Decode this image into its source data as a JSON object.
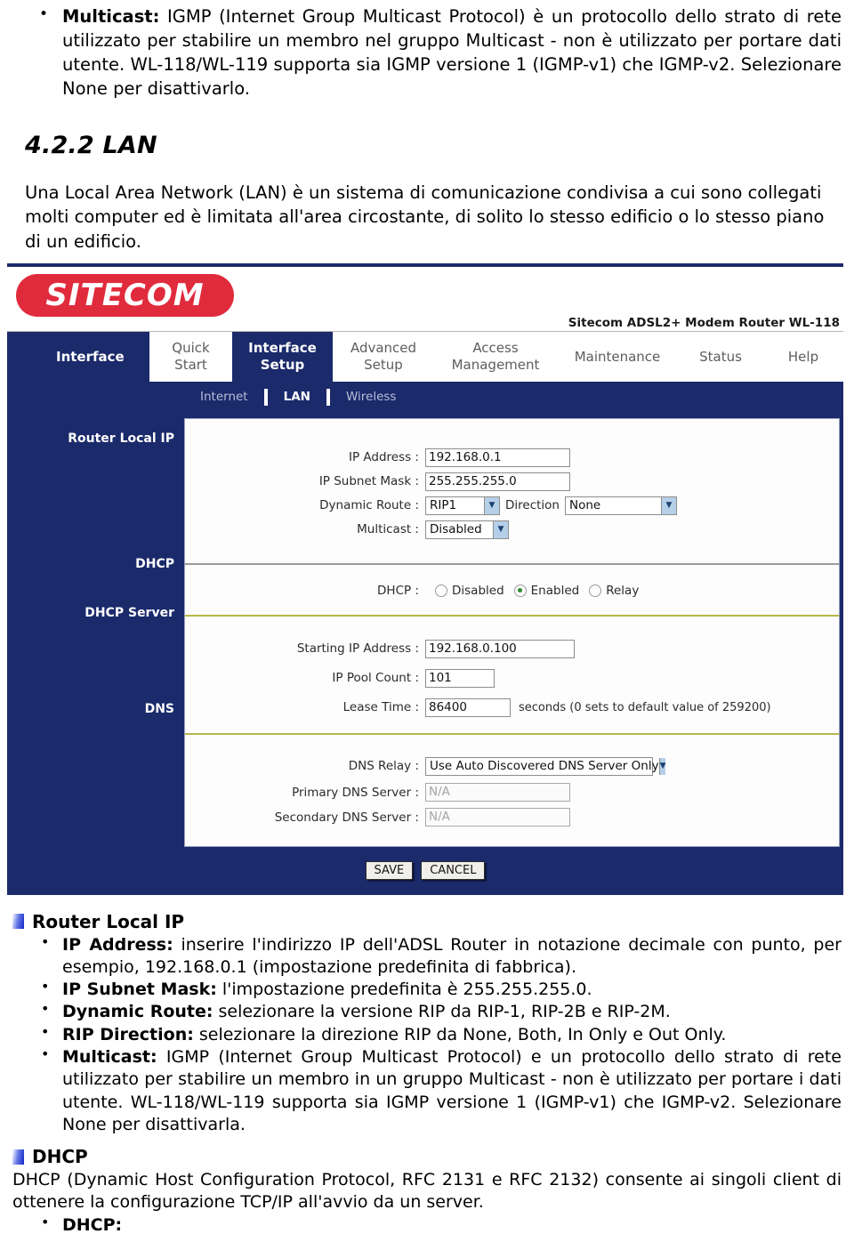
{
  "doc_top": {
    "multicast_bullet": {
      "label": "Multicast:",
      "text": " IGMP (Internet Group Multicast Protocol) è un protocollo dello strato di rete utilizzato per stabilire un membro nel gruppo Multicast - non è utilizzato per portare dati utente. WL-118/WL-119 supporta sia IGMP versione 1 (IGMP-v1) che IGMP-v2. Selezionare None per disattivarlo."
    },
    "section_title": "4.2.2 LAN",
    "intro": "Una Local Area Network (LAN) è un sistema di comunicazione condivisa a cui sono collegati molti computer ed è limitata all'area circostante, di solito lo stesso edificio o lo stesso piano di un edificio."
  },
  "router_ui": {
    "logo_text": "SITECOM",
    "model_name": "Sitecom ADSL2+ Modem Router WL-118",
    "nav_left_label": "Interface",
    "tabs": [
      {
        "line1": "Quick",
        "line2": "Start",
        "active": false
      },
      {
        "line1": "Interface",
        "line2": "Setup",
        "active": true
      },
      {
        "line1": "Advanced",
        "line2": "Setup",
        "active": false
      },
      {
        "line1": "Access",
        "line2": "Management",
        "active": false
      },
      {
        "line1": "Maintenance",
        "line2": "",
        "active": false
      },
      {
        "line1": "Status",
        "line2": "",
        "active": false
      },
      {
        "line1": "Help",
        "line2": "",
        "active": false
      }
    ],
    "subnav": [
      {
        "label": "Internet",
        "active": false
      },
      {
        "label": "LAN",
        "active": true
      },
      {
        "label": "Wireless",
        "active": false
      }
    ],
    "side_labels": {
      "router_local_ip": "Router Local IP",
      "dhcp": "DHCP",
      "dhcp_server": "DHCP Server",
      "dns": "DNS"
    },
    "router_local_ip": {
      "ip_address_label": "IP Address :",
      "ip_address_value": "192.168.0.1",
      "subnet_label": "IP Subnet Mask :",
      "subnet_value": "255.255.255.0",
      "dynamic_route_label": "Dynamic Route :",
      "dynamic_route_value": "RIP1",
      "direction_label": "Direction",
      "direction_value": "None",
      "multicast_label": "Multicast :",
      "multicast_value": "Disabled"
    },
    "dhcp": {
      "label": "DHCP :",
      "options": [
        {
          "label": "Disabled",
          "selected": false
        },
        {
          "label": "Enabled",
          "selected": true
        },
        {
          "label": "Relay",
          "selected": false
        }
      ]
    },
    "dhcp_server": {
      "starting_ip_label": "Starting IP Address :",
      "starting_ip_value": "192.168.0.100",
      "pool_count_label": "IP Pool Count :",
      "pool_count_value": "101",
      "lease_time_label": "Lease Time :",
      "lease_time_value": "86400",
      "lease_time_hint": "seconds   (0 sets to default value of 259200)"
    },
    "dns": {
      "dns_relay_label": "DNS Relay :",
      "dns_relay_value": "Use Auto Discovered DNS Server Only",
      "primary_label": "Primary DNS Server  :",
      "primary_value": "N/A",
      "secondary_label": "Secondary DNS Server :",
      "secondary_value": "N/A"
    },
    "buttons": {
      "save": "SAVE",
      "cancel": "CANCEL"
    },
    "colors": {
      "navy": "#1b2a6b",
      "brand_red": "#e02b3c",
      "olive_rule": "#b9b64a",
      "radio_green": "#2f8f2f"
    }
  },
  "doc_bottom": {
    "router_local_ip_heading": "Router Local IP",
    "bullets": [
      {
        "label": "IP Address:",
        "text": " inserire l'indirizzo IP dell'ADSL Router in notazione decimale con punto, per esempio, 192.168.0.1 (impostazione predefinita di fabbrica)."
      },
      {
        "label": "IP Subnet Mask:",
        "text": " l'impostazione predefinita è 255.255.255.0."
      },
      {
        "label": "Dynamic Route:",
        "text": " selezionare la versione RIP da RIP-1, RIP-2B e RIP-2M."
      },
      {
        "label": "RIP Direction:",
        "text": " selezionare la direzione RIP da None, Both, In Only e Out Only."
      },
      {
        "label": "Multicast:",
        "text": " IGMP (Internet Group Multicast Protocol) e un protocollo dello strato di rete utilizzato per stabilire un membro in un gruppo Multicast - non è utilizzato per portare i dati utente. WL-118/WL-119 supporta sia IGMP versione 1 (IGMP-v1) che IGMP-v2. Selezionare None per disattivarla."
      }
    ],
    "dhcp_heading": "DHCP",
    "dhcp_para": "DHCP (Dynamic Host Configuration Protocol, RFC 2131 e RFC 2132) consente ai singoli client di ottenere la configurazione TCP/IP all'avvio da un server.",
    "dhcp_bullet_label": "DHCP:"
  }
}
